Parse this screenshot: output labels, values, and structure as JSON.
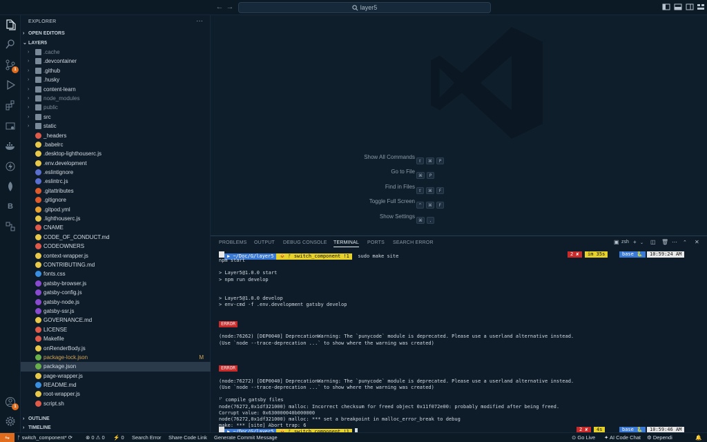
{
  "titlebar": {
    "search_text": "layer5"
  },
  "activity": {
    "scm_badge": "1",
    "account_badge": "1",
    "b_letter": "B"
  },
  "sidebar": {
    "title": "EXPLORER",
    "more": "···",
    "open_editors": "OPEN EDITORS",
    "project": "LAYER5",
    "outline": "OUTLINE",
    "timeline": "TIMELINE",
    "files": [
      {
        "name": ".cache",
        "type": "folder",
        "dim": true
      },
      {
        "name": ".devcontainer",
        "type": "folder"
      },
      {
        "name": ".github",
        "type": "folder"
      },
      {
        "name": ".husky",
        "type": "folder"
      },
      {
        "name": "content-learn",
        "type": "folder"
      },
      {
        "name": "node_modules",
        "type": "folder",
        "dim": true
      },
      {
        "name": "public",
        "type": "folder",
        "dim": true
      },
      {
        "name": "src",
        "type": "folder"
      },
      {
        "name": "static",
        "type": "folder"
      },
      {
        "name": "_headers",
        "color": "#e05a4a"
      },
      {
        "name": ".babelrc",
        "color": "#e8c84a"
      },
      {
        "name": ".desktop-lighthouserc.js",
        "color": "#e8c84a"
      },
      {
        "name": ".env.development",
        "color": "#e8c84a"
      },
      {
        "name": ".eslintignore",
        "color": "#5a6fd0"
      },
      {
        "name": ".eslintrc.js",
        "color": "#5a6fd0"
      },
      {
        "name": ".gitattributes",
        "color": "#e05a2a"
      },
      {
        "name": ".gitignore",
        "color": "#e05a2a"
      },
      {
        "name": ".gitpod.yml",
        "color": "#e8a030"
      },
      {
        "name": ".lighthouserc.js",
        "color": "#e8c84a"
      },
      {
        "name": "CNAME",
        "color": "#e05a4a"
      },
      {
        "name": "CODE_OF_CONDUCT.md",
        "color": "#e8c84a"
      },
      {
        "name": "CODEOWNERS",
        "color": "#e05a4a"
      },
      {
        "name": "context-wrapper.js",
        "color": "#e8c84a"
      },
      {
        "name": "CONTRIBUTING.md",
        "color": "#e8c84a"
      },
      {
        "name": "fonts.css",
        "color": "#3a8ee0"
      },
      {
        "name": "gatsby-browser.js",
        "color": "#8a4ad0"
      },
      {
        "name": "gatsby-config.js",
        "color": "#8a4ad0"
      },
      {
        "name": "gatsby-node.js",
        "color": "#8a4ad0"
      },
      {
        "name": "gatsby-ssr.js",
        "color": "#8a4ad0"
      },
      {
        "name": "GOVERNANCE.md",
        "color": "#e8c84a"
      },
      {
        "name": "LICENSE",
        "color": "#e05a4a"
      },
      {
        "name": "Makefile",
        "color": "#e05a4a"
      },
      {
        "name": "onRenderBody.js",
        "color": "#e8c84a"
      },
      {
        "name": "package-lock.json",
        "color": "#6ab04a",
        "modified": true,
        "status": "M"
      },
      {
        "name": "package.json",
        "color": "#6ab04a",
        "selected": true
      },
      {
        "name": "page-wrapper.js",
        "color": "#e8c84a"
      },
      {
        "name": "README.md",
        "color": "#3a8ee0"
      },
      {
        "name": "root-wrapper.js",
        "color": "#e8c84a"
      },
      {
        "name": "script.sh",
        "color": "#e05a4a"
      }
    ]
  },
  "shortcuts": [
    {
      "label": "Show All Commands",
      "keys": [
        "⇧",
        "⌘",
        "P"
      ]
    },
    {
      "label": "Go to File",
      "keys": [
        "⌘",
        "P"
      ]
    },
    {
      "label": "Find in Files",
      "keys": [
        "⇧",
        "⌘",
        "F"
      ]
    },
    {
      "label": "Toggle Full Screen",
      "keys": [
        "^",
        "⌘",
        "F"
      ]
    },
    {
      "label": "Show Settings",
      "keys": [
        "⌘",
        ","
      ]
    }
  ],
  "panel": {
    "tabs": [
      "PROBLEMS",
      "OUTPUT",
      "DEBUG CONSOLE",
      "TERMINAL",
      "PORTS",
      "SEARCH ERROR"
    ],
    "active_tab": "TERMINAL",
    "shell": "zsh"
  },
  "terminal": {
    "prompt1": {
      "path": "~/Doc/G/layer5",
      "branch": "switch_component !1",
      "command": "sudo make site",
      "err": "2 ✘",
      "time1": "im 35s",
      "env": "base 🐍",
      "clock": "10:59:24 AM"
    },
    "lines": [
      "npm start",
      "",
      "> Layer5@1.0.0 start",
      "> npm run develop",
      "",
      "",
      "> Layer5@1.0.0 develop",
      "> env-cmd -f .env.development gatsby develop"
    ],
    "error_label": "ERROR",
    "block1": [
      "(node:76262) [DEP0040] DeprecationWarning: The `punycode` module is deprecated. Please use a userland alternative instead.",
      "(Use `node --trace-deprecation ...` to show where the warning was created)"
    ],
    "block2": [
      "(node:76272) [DEP0040] DeprecationWarning: The `punycode` module is deprecated. Please use a userland alternative instead.",
      "(Use `node --trace-deprecation ...` to show where the warning was created)",
      "",
      "⠋ compile gatsby files",
      "node(76272,0x1df321000) malloc: Incorrect checksum for freed object 0x11f072e00: probably modified after being freed.",
      "Corrupt value: 0x630000040b000000",
      "node(76272,0x1df321000) malloc: *** set a breakpoint in malloc_error_break to debug",
      "make: *** [site] Abort trap: 6"
    ],
    "prompt2": {
      "path": "~/Doc/G/layer5",
      "branch": "switch_component !1",
      "err": "2 ✘",
      "time1": "4s",
      "env": "base 🐍",
      "clock": "10:59:46 AM"
    }
  },
  "status": {
    "branch": "switch_component*",
    "errors": "0",
    "warnings": "0",
    "ports": "0",
    "search_error": "Search Error",
    "share": "Share Code Link",
    "commit": "Generate Commit Message",
    "golive": "Go Live",
    "ai": "AI Code Chat",
    "dependi": "Dependi"
  }
}
